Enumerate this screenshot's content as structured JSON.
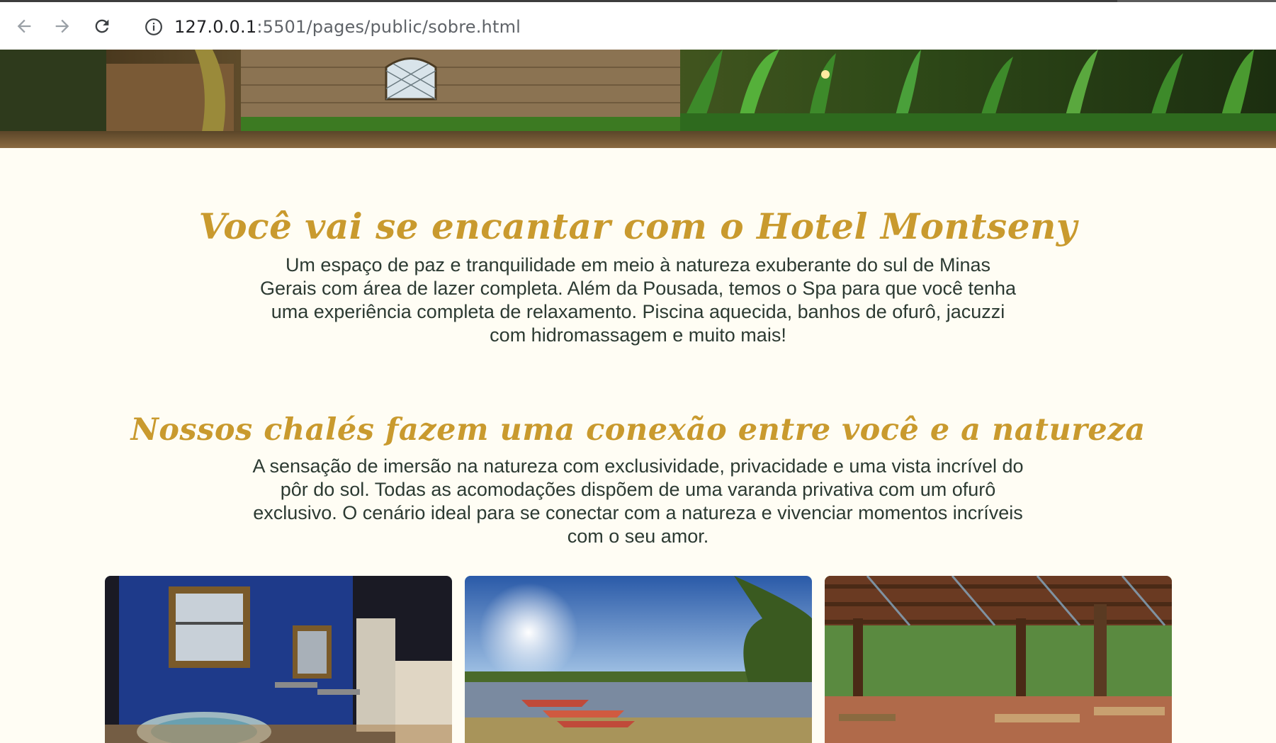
{
  "browser": {
    "url_host": "127.0.0.1",
    "url_rest": ":5501/pages/public/sobre.html",
    "back_icon": "arrow-left-icon",
    "forward_icon": "arrow-right-icon",
    "reload_icon": "reload-icon",
    "info_icon": "info-icon"
  },
  "intro": {
    "title": "Você vai se encantar com o Hotel Montseny",
    "text": "Um espaço de paz e tranquilidade em meio à natureza exuberante do sul de Minas Gerais com área de lazer completa. Além da Pousada, temos o Spa para que você tenha uma experiência completa de relaxamento. Piscina aquecida, banhos de ofurô, jacuzzi com hidromassagem e muito mais!"
  },
  "chalets": {
    "title": "Nossos chalés fazem uma conexão entre você e a natureza",
    "text": "A sensação de imersão na natureza com exclusividade, privacidade e uma vista incrível do pôr do sol. Todas as acomodações dispõem de uma varanda privativa com um ofurô exclusivo. O cenário ideal para se conectar com a natureza e vivenciar momentos incríveis com o seu amor."
  },
  "colors": {
    "accent": "#c99a2e",
    "text": "#2c3a32",
    "background": "#fffdf4"
  }
}
